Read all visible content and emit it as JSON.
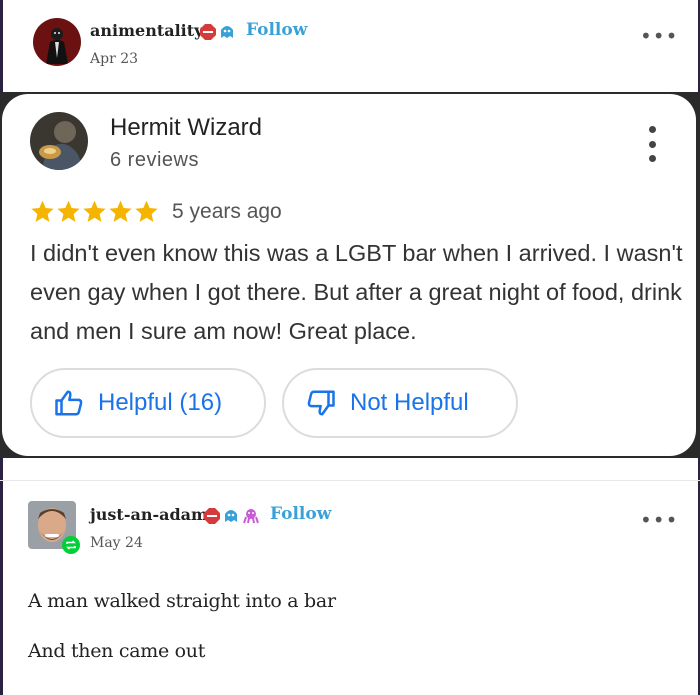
{
  "post1": {
    "username": "animentality",
    "follow": "Follow",
    "date": "Apr 23",
    "more": "•••"
  },
  "review": {
    "reviewer": "Hermit Wizard",
    "review_count": "6 reviews",
    "rating": 5,
    "time_ago": "5 years ago",
    "text": "I didn't even know this was a LGBT bar when I arrived. I wasn't even gay when I got there. But after a great night of food, drink and men I sure am now! Great place.",
    "helpful_label": "Helpful (16)",
    "not_helpful_label": "Not Helpful",
    "colors": {
      "star": "#f4b400",
      "accent": "#1a73e8"
    }
  },
  "post2": {
    "username": "just-an-adam",
    "follow": "Follow",
    "date": "May 24",
    "more": "•••",
    "lines": [
      "A man walked straight into a bar",
      "And then came out"
    ]
  },
  "colors": {
    "follow": "#3aa1d8"
  }
}
